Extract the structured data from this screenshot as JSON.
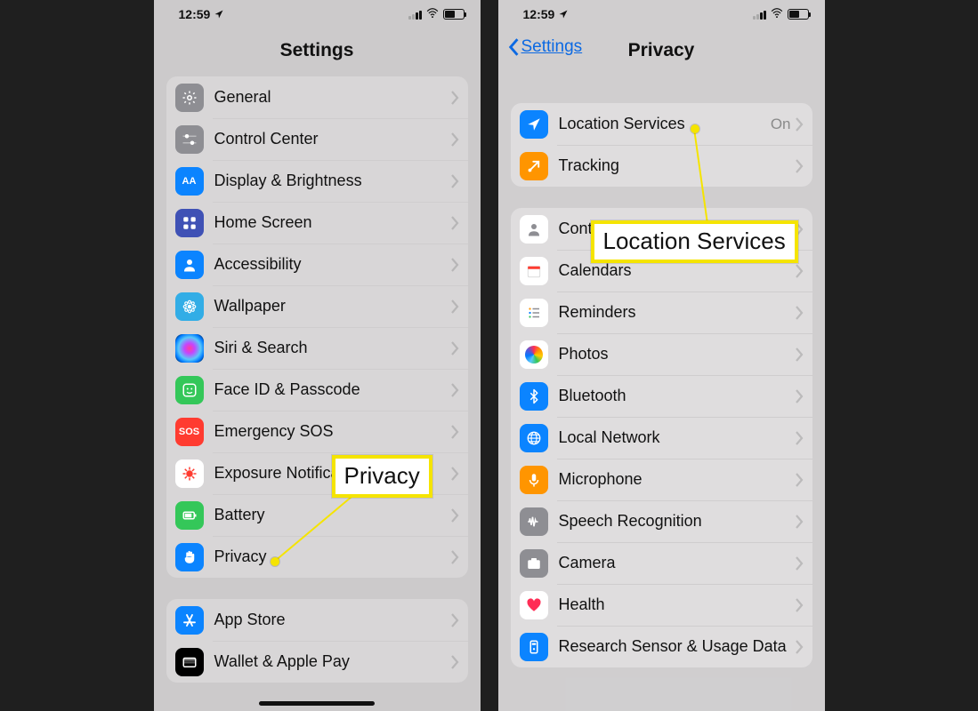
{
  "status": {
    "time": "12:59"
  },
  "left": {
    "title": "Settings",
    "group1": [
      {
        "label": "General"
      },
      {
        "label": "Control Center"
      },
      {
        "label": "Display & Brightness"
      },
      {
        "label": "Home Screen"
      },
      {
        "label": "Accessibility"
      },
      {
        "label": "Wallpaper"
      },
      {
        "label": "Siri & Search"
      },
      {
        "label": "Face ID & Passcode"
      },
      {
        "label": "Emergency SOS"
      },
      {
        "label": "Exposure Notifications"
      },
      {
        "label": "Battery"
      },
      {
        "label": "Privacy"
      }
    ],
    "group2": [
      {
        "label": "App Store"
      },
      {
        "label": "Wallet & Apple Pay"
      }
    ],
    "callout": "Privacy"
  },
  "right": {
    "back": "Settings",
    "title": "Privacy",
    "group1": [
      {
        "label": "Location Services",
        "value": "On"
      },
      {
        "label": "Tracking"
      }
    ],
    "group2": [
      {
        "label": "Contacts"
      },
      {
        "label": "Calendars"
      },
      {
        "label": "Reminders"
      },
      {
        "label": "Photos"
      },
      {
        "label": "Bluetooth"
      },
      {
        "label": "Local Network"
      },
      {
        "label": "Microphone"
      },
      {
        "label": "Speech Recognition"
      },
      {
        "label": "Camera"
      },
      {
        "label": "Health"
      },
      {
        "label": "Research Sensor & Usage Data"
      }
    ],
    "callout": "Location Services"
  }
}
